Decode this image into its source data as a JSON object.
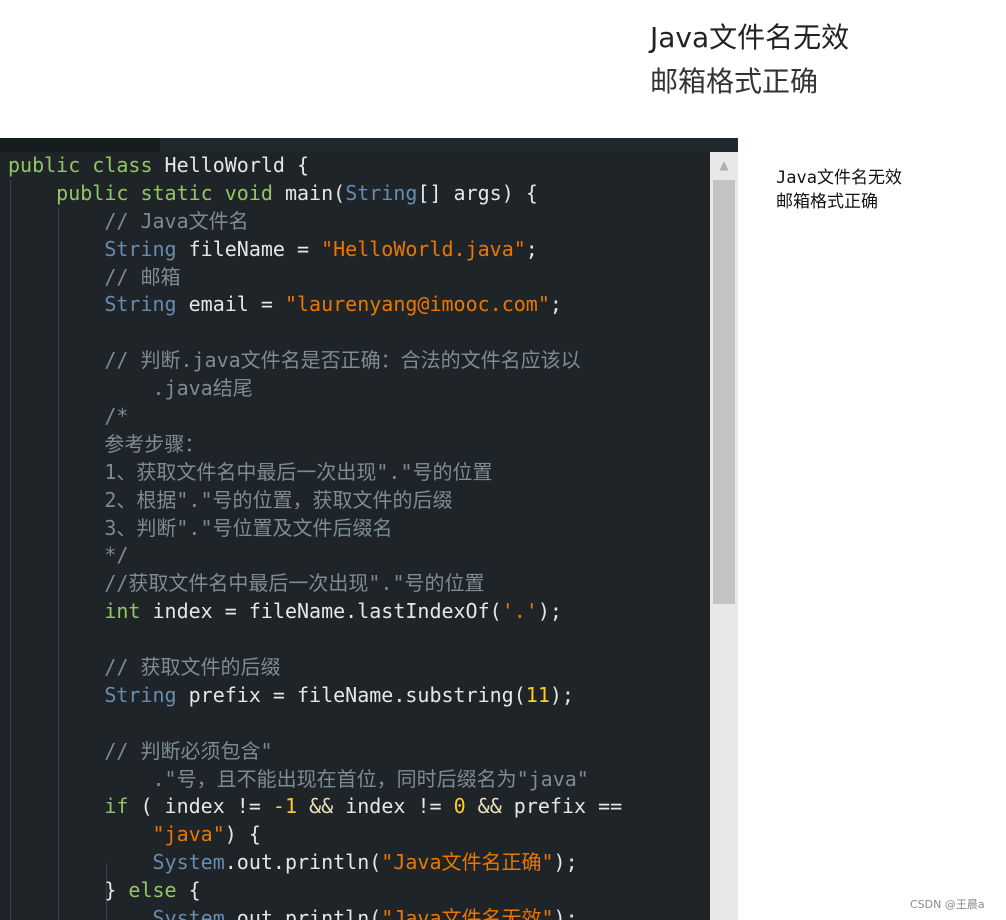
{
  "output_top": {
    "line1": "Java文件名无效",
    "line2": "邮箱格式正确"
  },
  "output_side": {
    "line1": "Java文件名无效",
    "line2": "邮箱格式正确"
  },
  "code_lines": [
    {
      "indent": "",
      "tokens": [
        {
          "t": "public",
          "c": "kw"
        },
        {
          "t": " "
        },
        {
          "t": "class",
          "c": "kw"
        },
        {
          "t": " HelloWorld {"
        }
      ]
    },
    {
      "indent": "    ",
      "tokens": [
        {
          "t": "public",
          "c": "kw"
        },
        {
          "t": " "
        },
        {
          "t": "static",
          "c": "kw"
        },
        {
          "t": " "
        },
        {
          "t": "void",
          "c": "kw"
        },
        {
          "t": " main("
        },
        {
          "t": "String",
          "c": "kw2"
        },
        {
          "t": "[] args) {"
        }
      ]
    },
    {
      "indent": "        ",
      "tokens": [
        {
          "t": "// Java文件名",
          "c": "cm"
        }
      ]
    },
    {
      "indent": "        ",
      "tokens": [
        {
          "t": "String",
          "c": "kw2"
        },
        {
          "t": " fileName = "
        },
        {
          "t": "\"HelloWorld.java\"",
          "c": "str"
        },
        {
          "t": ";"
        }
      ]
    },
    {
      "indent": "        ",
      "tokens": [
        {
          "t": "// 邮箱",
          "c": "cm"
        }
      ]
    },
    {
      "indent": "        ",
      "tokens": [
        {
          "t": "String",
          "c": "kw2"
        },
        {
          "t": " email = "
        },
        {
          "t": "\"laurenyang@imooc.com\"",
          "c": "str"
        },
        {
          "t": ";"
        }
      ]
    },
    {
      "indent": "",
      "tokens": []
    },
    {
      "indent": "        ",
      "tokens": [
        {
          "t": "// 判断.java文件名是否正确：合法的文件名应该以",
          "c": "cm"
        }
      ]
    },
    {
      "indent": "            ",
      "tokens": [
        {
          "t": ".java结尾",
          "c": "cm"
        }
      ]
    },
    {
      "indent": "        ",
      "tokens": [
        {
          "t": "/*",
          "c": "cm"
        }
      ]
    },
    {
      "indent": "        ",
      "tokens": [
        {
          "t": "参考步骤：",
          "c": "cm"
        }
      ]
    },
    {
      "indent": "        ",
      "tokens": [
        {
          "t": "1、获取文件名中最后一次出现\".\"号的位置",
          "c": "cm"
        }
      ]
    },
    {
      "indent": "        ",
      "tokens": [
        {
          "t": "2、根据\".\"号的位置，获取文件的后缀",
          "c": "cm"
        }
      ]
    },
    {
      "indent": "        ",
      "tokens": [
        {
          "t": "3、判断\".\"号位置及文件后缀名",
          "c": "cm"
        }
      ]
    },
    {
      "indent": "        ",
      "tokens": [
        {
          "t": "*/",
          "c": "cm"
        }
      ]
    },
    {
      "indent": "        ",
      "tokens": [
        {
          "t": "//获取文件名中最后一次出现\".\"号的位置",
          "c": "cm"
        }
      ]
    },
    {
      "indent": "        ",
      "tokens": [
        {
          "t": "int",
          "c": "kw"
        },
        {
          "t": " index = fileName.lastIndexOf("
        },
        {
          "t": "'.'",
          "c": "str"
        },
        {
          "t": ");"
        }
      ]
    },
    {
      "indent": "",
      "tokens": []
    },
    {
      "indent": "        ",
      "tokens": [
        {
          "t": "// 获取文件的后缀",
          "c": "cm"
        }
      ]
    },
    {
      "indent": "        ",
      "tokens": [
        {
          "t": "String",
          "c": "kw2"
        },
        {
          "t": " prefix = fileName.substring("
        },
        {
          "t": "11",
          "c": "num"
        },
        {
          "t": ");"
        }
      ]
    },
    {
      "indent": "",
      "tokens": []
    },
    {
      "indent": "        ",
      "tokens": [
        {
          "t": "// 判断必须包含\"",
          "c": "cm"
        }
      ]
    },
    {
      "indent": "            ",
      "tokens": [
        {
          "t": ".\"号，且不能出现在首位，同时后缀名为\"java\"",
          "c": "cm"
        }
      ]
    },
    {
      "indent": "        ",
      "tokens": [
        {
          "t": "if",
          "c": "kw"
        },
        {
          "t": " ( index != "
        },
        {
          "t": "-1",
          "c": "num"
        },
        {
          "t": " "
        },
        {
          "t": "&&",
          "c": "op"
        },
        {
          "t": " index != "
        },
        {
          "t": "0",
          "c": "num"
        },
        {
          "t": " "
        },
        {
          "t": "&&",
          "c": "op"
        },
        {
          "t": " prefix =="
        }
      ]
    },
    {
      "indent": "            ",
      "tokens": [
        {
          "t": "\"java\"",
          "c": "str"
        },
        {
          "t": ") {"
        }
      ]
    },
    {
      "indent": "            ",
      "tokens": [
        {
          "t": "System",
          "c": "kw2"
        },
        {
          "t": ".out.println("
        },
        {
          "t": "\"Java文件名正确\"",
          "c": "str"
        },
        {
          "t": ");"
        }
      ]
    },
    {
      "indent": "        ",
      "tokens": [
        {
          "t": "} "
        },
        {
          "t": "else",
          "c": "kw"
        },
        {
          "t": " {"
        }
      ]
    },
    {
      "indent": "            ",
      "tokens": [
        {
          "t": "System",
          "c": "kw2"
        },
        {
          "t": ".out.println("
        },
        {
          "t": "\"Java文件名无效\"",
          "c": "str"
        },
        {
          "t": ");"
        }
      ]
    }
  ],
  "watermark": "CSDN @王晨a",
  "colors": {
    "editor_bg": "#1e2428",
    "keyword": "#93c763",
    "type": "#678cb1",
    "string": "#ec7600",
    "number": "#ffcd22",
    "comment": "#7d8c93"
  }
}
